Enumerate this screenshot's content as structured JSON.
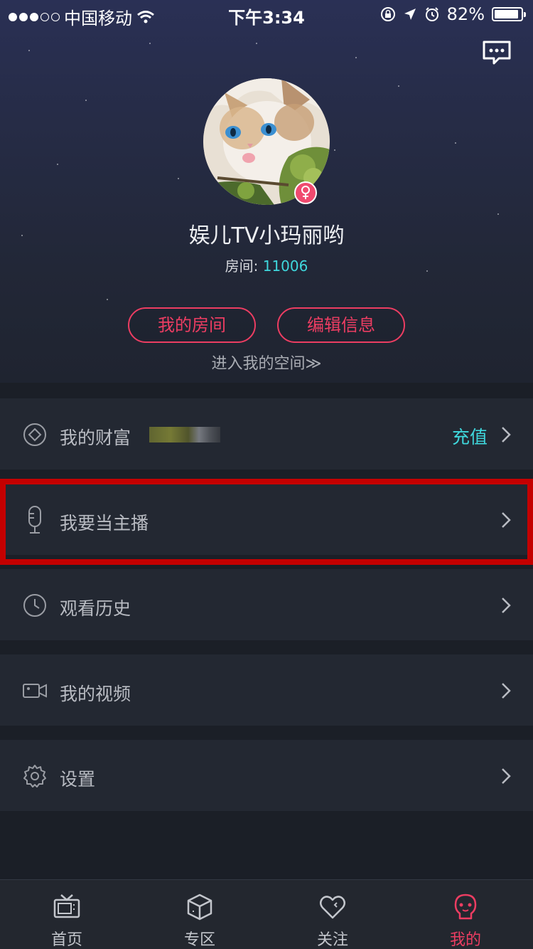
{
  "status_bar": {
    "carrier": "中国移动",
    "time": "下午3:34",
    "battery": "82%"
  },
  "profile": {
    "username": "娱儿TV小玛丽哟",
    "room_label": "房间: ",
    "room_number": "11006",
    "my_room_button": "我的房间",
    "edit_info_button": "编辑信息",
    "enter_space_link": "进入我的空间≫"
  },
  "menu": {
    "wealth": {
      "label": "我的财富",
      "action": "充值"
    },
    "become_host": {
      "label": "我要当主播"
    },
    "history": {
      "label": "观看历史"
    },
    "videos": {
      "label": "我的视频"
    },
    "settings": {
      "label": "设置"
    }
  },
  "tabbar": {
    "tabs": [
      {
        "label": "首页",
        "icon": "tv-icon"
      },
      {
        "label": "专区",
        "icon": "cube-icon"
      },
      {
        "label": "关注",
        "icon": "heart-icon"
      },
      {
        "label": "我的",
        "icon": "user-icon"
      }
    ],
    "active_index": 3
  },
  "colors": {
    "accent": "#ec3d62",
    "highlight": "#3fd7dc",
    "annotation_box": "#c40000",
    "background": "#1b1f27"
  }
}
